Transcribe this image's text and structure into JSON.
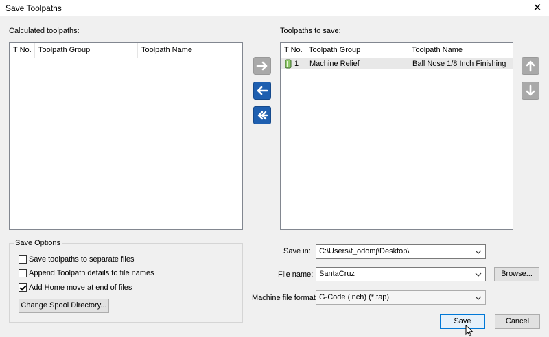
{
  "window": {
    "title": "Save Toolpaths"
  },
  "calculated": {
    "label": "Calculated toolpaths:",
    "columns": [
      "T No.",
      "Toolpath Group",
      "Toolpath Name"
    ]
  },
  "to_save": {
    "label": "Toolpaths to save:",
    "columns": [
      "T No.",
      "Toolpath Group",
      "Toolpath Name"
    ],
    "rows": [
      {
        "tno": "1",
        "group": "Machine Relief",
        "name": "Ball Nose 1/8 Inch  Finishing"
      }
    ]
  },
  "icons": {
    "move_right": "arrow-right-icon",
    "move_left": "arrow-left-icon",
    "move_all_left": "double-arrow-left-icon",
    "move_up": "arrow-up-icon",
    "move_down": "arrow-down-icon",
    "tool": "tool-bit-icon"
  },
  "colors": {
    "accent_blue": "#1e5fb0",
    "disabled_grey": "#a9a9a9"
  },
  "save_options": {
    "title": "Save Options",
    "separate_files": {
      "label": "Save toolpaths to separate files",
      "checked": false
    },
    "append_details": {
      "label": "Append Toolpath details to file names",
      "checked": false
    },
    "add_home": {
      "label": "Add Home move at end of files",
      "checked": true
    },
    "spool_button": "Change Spool Directory..."
  },
  "form": {
    "save_in_label": "Save in:",
    "save_in_value": "C:\\Users\\t_odomj\\Desktop\\",
    "file_name_label": "File name:",
    "file_name_value": "SantaCruz",
    "browse_button": "Browse...",
    "format_label": "Machine file format:",
    "format_value": "G-Code (inch) (*.tap)"
  },
  "buttons": {
    "save": "Save",
    "cancel": "Cancel"
  }
}
